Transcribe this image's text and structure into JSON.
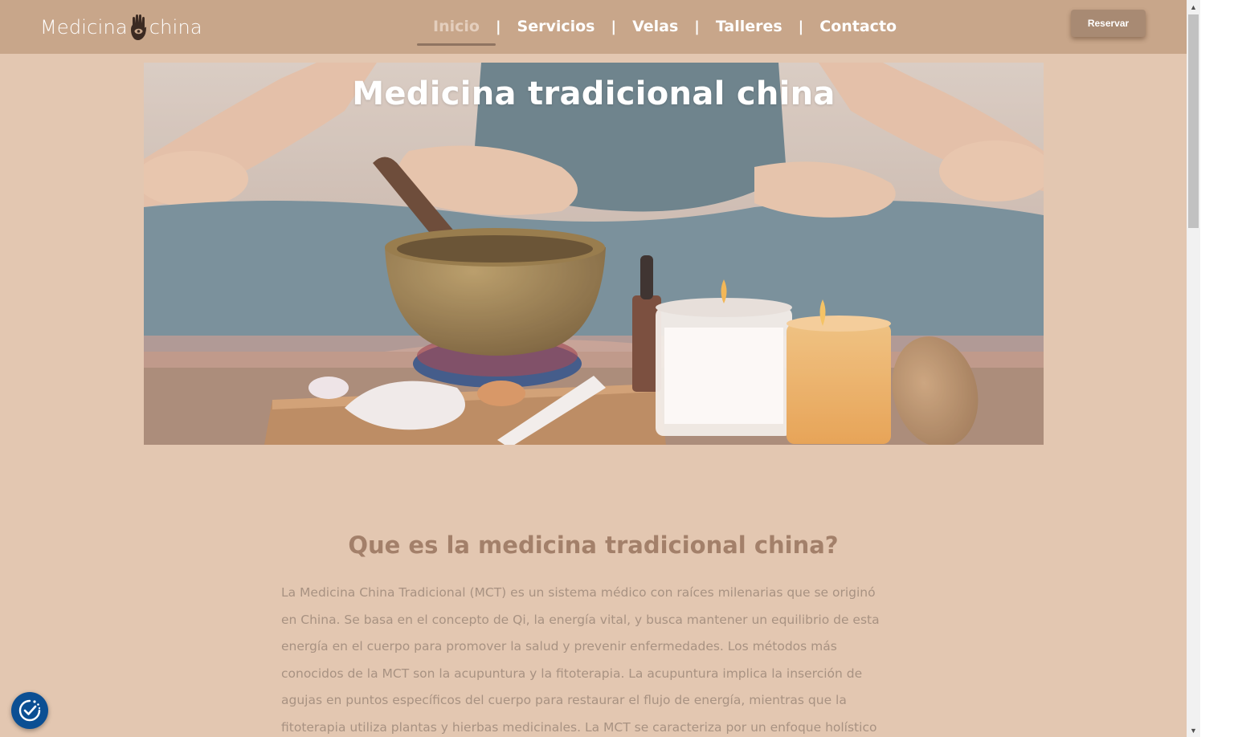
{
  "header": {
    "logo_left": "Medicina",
    "logo_right": "china",
    "nav": [
      {
        "label": "Inicio",
        "active": true
      },
      {
        "label": "Servicios",
        "active": false
      },
      {
        "label": "Velas",
        "active": false
      },
      {
        "label": "Talleres",
        "active": false
      },
      {
        "label": "Contacto",
        "active": false
      }
    ],
    "separator": "|",
    "reserve_label": "Reservar"
  },
  "hero": {
    "title": "Medicina tradicional china"
  },
  "section": {
    "title": "Que es la medicina tradicional china?",
    "lines": [
      "La Medicina China Tradicional (MCT) es un sistema médico con raíces milenarias que se originó",
      "en China. Se basa en el concepto de Qi, la energía vital, y busca mantener un equilibrio de esta",
      "energía en el cuerpo para promover la salud y prevenir enfermedades. Los métodos más",
      "conocidos de la MCT son la acupuntura y la fitoterapia. La acupuntura implica la inserción de",
      "agujas en puntos específicos del cuerpo para restaurar el flujo de energía, mientras que la",
      "fitoterapia utiliza plantas y hierbas medicinales. La MCT se caracteriza por un enfoque holístico"
    ]
  },
  "colors": {
    "header_bg": "#c8a68a",
    "page_bg": "#e3c7b1",
    "heading": "#a3806a",
    "body_text": "#a89282",
    "consent_badge": "#0b4f93"
  },
  "icons": {
    "logo_mark": "hamsa-hand-icon",
    "consent": "cookie-consent-icon",
    "scroll_up": "scroll-up-arrow-icon",
    "scroll_down": "scroll-down-arrow-icon"
  }
}
